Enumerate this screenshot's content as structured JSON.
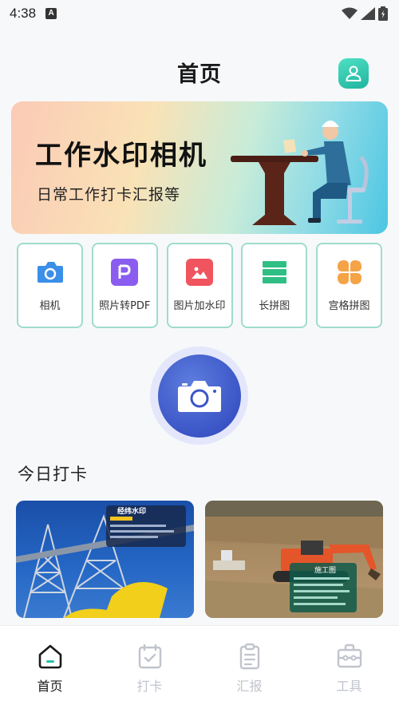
{
  "status_bar": {
    "time": "4:38",
    "app_icon_letter": "A",
    "icons": [
      "wifi-icon",
      "signal-icon",
      "battery-icon"
    ]
  },
  "header": {
    "title": "首页",
    "profile_icon": "user-icon"
  },
  "banner": {
    "title": "工作水印相机",
    "subtitle": "日常工作打卡汇报等"
  },
  "tools": [
    {
      "label": "相机",
      "icon": "camera-icon",
      "color": "#3b8fe8"
    },
    {
      "label": "照片转PDF",
      "icon": "pdf-icon",
      "color": "#8a5cf0"
    },
    {
      "label": "图片加水印",
      "icon": "image-icon",
      "color": "#f0545e"
    },
    {
      "label": "长拼图",
      "icon": "stack-icon",
      "color": "#2fbf84"
    },
    {
      "label": "宫格拼图",
      "icon": "grid-icon",
      "color": "#f4a347"
    }
  ],
  "main_camera_icon": "camera-icon",
  "section": {
    "title": "今日打卡"
  },
  "photos": [
    {
      "watermark_title": "经纬水印",
      "icon": "construction-photo"
    },
    {
      "watermark_title": "施工图",
      "icon": "excavator-photo"
    }
  ],
  "bottom_nav": [
    {
      "label": "首页",
      "icon": "home-icon",
      "active": true
    },
    {
      "label": "打卡",
      "icon": "calendar-check-icon",
      "active": false
    },
    {
      "label": "汇报",
      "icon": "clipboard-icon",
      "active": false
    },
    {
      "label": "工具",
      "icon": "toolbox-icon",
      "active": false
    }
  ],
  "colors": {
    "accent": "#3b55c6",
    "border": "#9fdccd",
    "avatar": "#26c0a8"
  }
}
